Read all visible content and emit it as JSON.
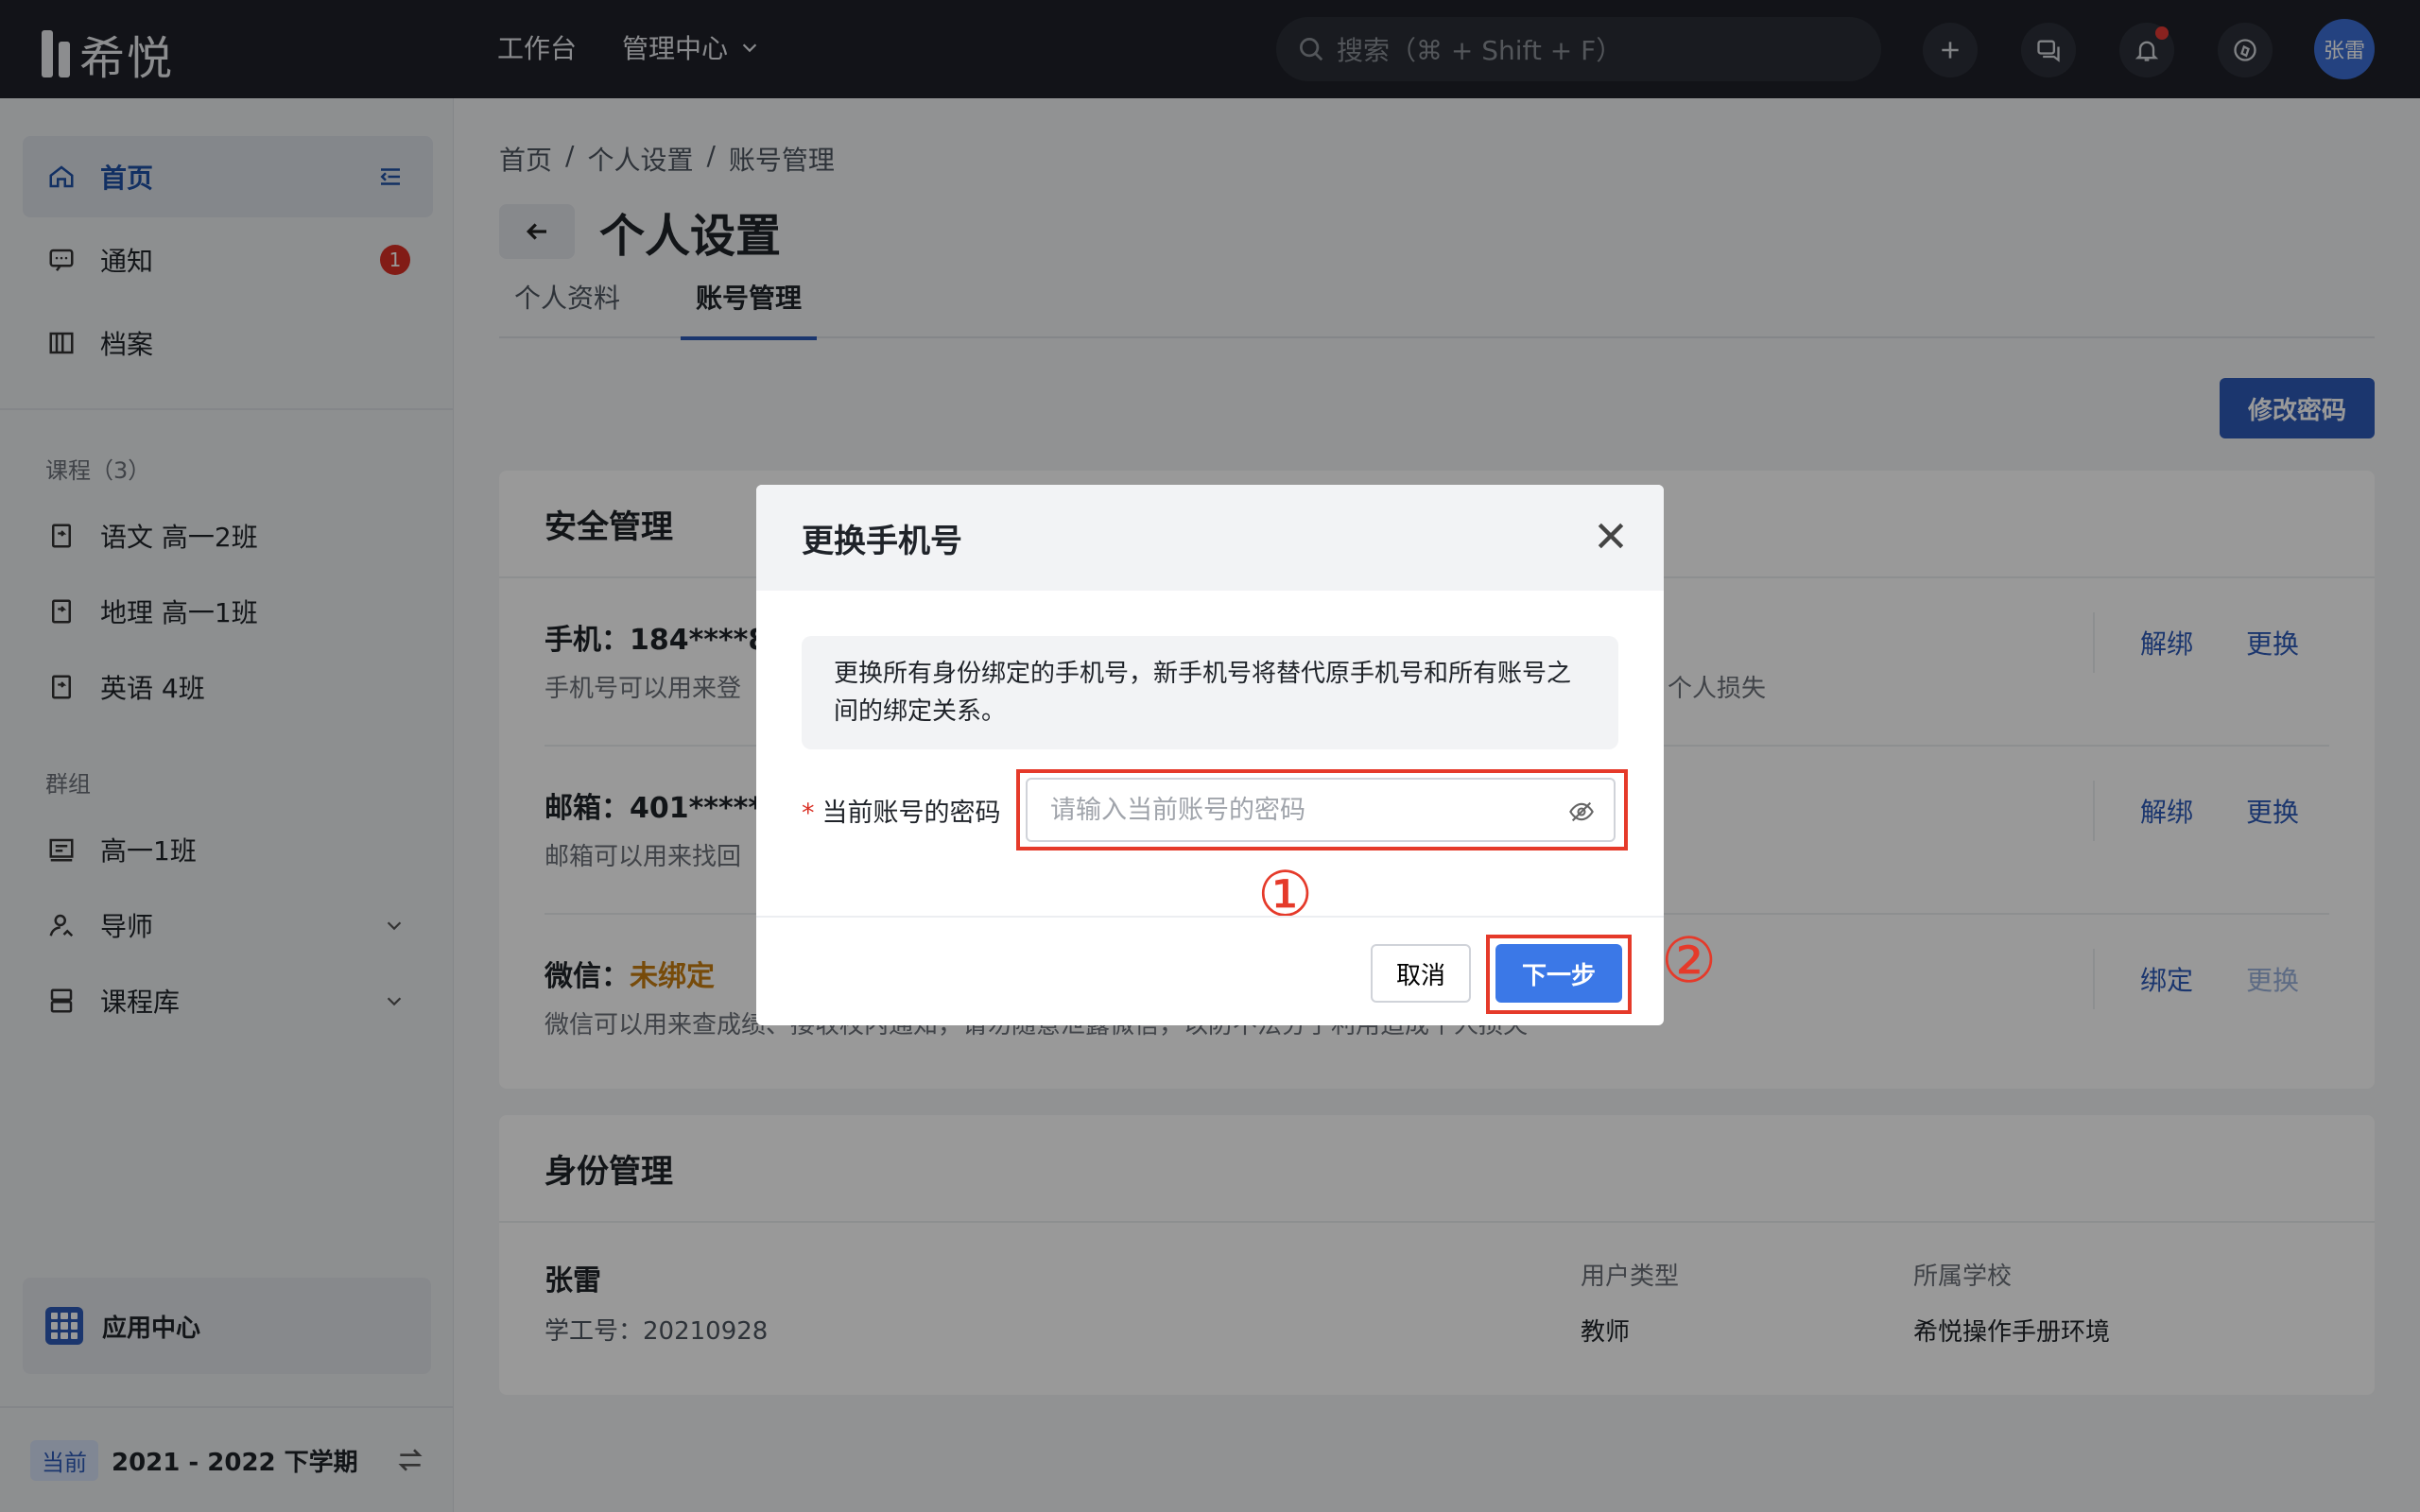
{
  "app": {
    "logo_text": "希悦"
  },
  "topnav": {
    "workbench": "工作台",
    "management": "管理中心"
  },
  "search": {
    "placeholder": "搜索（⌘ + Shift + F）"
  },
  "user": {
    "avatar_text": "张雷"
  },
  "sidebar": {
    "home": "首页",
    "notice": "通知",
    "notice_badge": "1",
    "archive": "档案",
    "courses_header": "课程（3）",
    "courses": [
      "语文 高一2班",
      "地理 高一1班",
      "英语 4班"
    ],
    "groups_header": "群组",
    "groups": [
      "高一1班",
      "导师",
      "课程库"
    ],
    "app_center": "应用中心",
    "term_tag": "当前",
    "term": "2021 - 2022 下学期"
  },
  "breadcrumb": [
    "首页",
    "/",
    "个人设置",
    "/",
    "账号管理"
  ],
  "page": {
    "title": "个人设置",
    "tabs": [
      "个人资料",
      "账号管理"
    ],
    "change_password": "修改密码"
  },
  "security": {
    "title": "安全管理",
    "phone_label": "手机：184****8",
    "phone_desc": "手机号可以用来登",
    "phone_desc_tail": "个人损失",
    "email_label": "邮箱：401******",
    "email_desc": "邮箱可以用来找回",
    "wechat_label": "微信：",
    "wechat_status": "未绑定",
    "wechat_desc": "微信可以用来查成绩、接收校内通知，请勿随意泄露微信，以防不法分子利用造成个人损失",
    "unbind": "解绑",
    "replace": "更换",
    "bind": "绑定"
  },
  "identity": {
    "title": "身份管理",
    "name": "张雷",
    "staff_no": "学工号：20210928",
    "type_label": "用户类型",
    "type_value": "教师",
    "school_label": "所属学校",
    "school_value": "希悦操作手册环境"
  },
  "modal": {
    "title": "更换手机号",
    "notice": "更换所有身份绑定的手机号，新手机号将替代原手机号和所有账号之间的绑定关系。",
    "field_label": "当前账号的密码",
    "field_required": "*",
    "field_placeholder": "请输入当前账号的密码",
    "cancel": "取消",
    "next": "下一步",
    "mark1": "①",
    "mark2": "②"
  },
  "colors": {
    "accent": "#2e5bb8",
    "highlight": "#e53a2a",
    "primary_button": "#3b78e7"
  }
}
